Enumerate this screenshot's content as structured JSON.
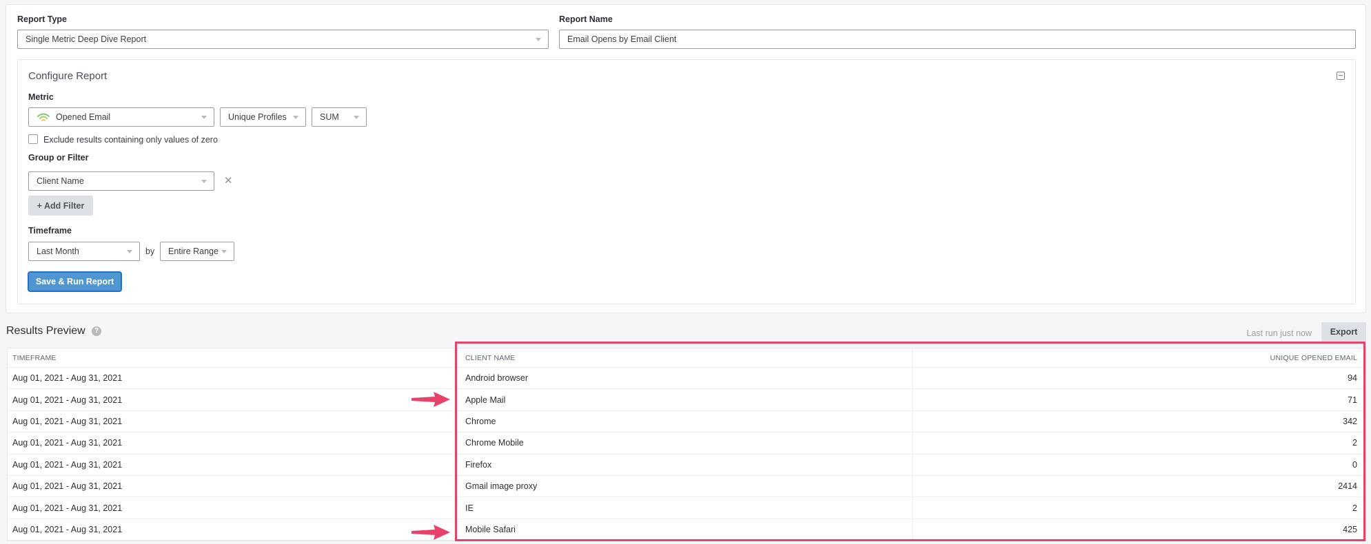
{
  "report_type": {
    "label": "Report Type",
    "value": "Single Metric Deep Dive Report"
  },
  "report_name": {
    "label": "Report Name",
    "value": "Email Opens by Email Client"
  },
  "configure": {
    "title": "Configure Report",
    "collapse_icon": "minus-square-icon",
    "metric": {
      "label": "Metric",
      "event": "Opened Email",
      "event_icon": "email-open-signal-icon",
      "aggregation_type": "Unique Profiles",
      "function": "SUM"
    },
    "exclude_zero": {
      "label": "Exclude results containing only values of zero",
      "checked": false
    },
    "group": {
      "label": "Group or Filter",
      "value": "Client Name",
      "remove_icon": "close-icon",
      "add_filter_label": "+ Add Filter"
    },
    "timeframe": {
      "label": "Timeframe",
      "range": "Last Month",
      "by_label": "by",
      "interval": "Entire Range"
    },
    "save_run_label": "Save & Run Report"
  },
  "results": {
    "title": "Results Preview",
    "help_icon": "question-circle-icon",
    "last_run": "Last run just now",
    "export_label": "Export",
    "columns": [
      "TIMEFRAME",
      "CLIENT NAME",
      "UNIQUE OPENED EMAIL"
    ],
    "rows": [
      {
        "timeframe": "Aug 01, 2021 - Aug 31, 2021",
        "client": "Android browser",
        "value": "94"
      },
      {
        "timeframe": "Aug 01, 2021 - Aug 31, 2021",
        "client": "Apple Mail",
        "value": "71"
      },
      {
        "timeframe": "Aug 01, 2021 - Aug 31, 2021",
        "client": "Chrome",
        "value": "342"
      },
      {
        "timeframe": "Aug 01, 2021 - Aug 31, 2021",
        "client": "Chrome Mobile",
        "value": "2"
      },
      {
        "timeframe": "Aug 01, 2021 - Aug 31, 2021",
        "client": "Firefox",
        "value": "0"
      },
      {
        "timeframe": "Aug 01, 2021 - Aug 31, 2021",
        "client": "Gmail image proxy",
        "value": "2414"
      },
      {
        "timeframe": "Aug 01, 2021 - Aug 31, 2021",
        "client": "IE",
        "value": "2"
      },
      {
        "timeframe": "Aug 01, 2021 - Aug 31, 2021",
        "client": "Mobile Safari",
        "value": "425"
      }
    ]
  },
  "annotations": {
    "highlight_color": "#e8426b",
    "arrows_point_to": [
      "Apple Mail",
      "Mobile Safari"
    ]
  }
}
